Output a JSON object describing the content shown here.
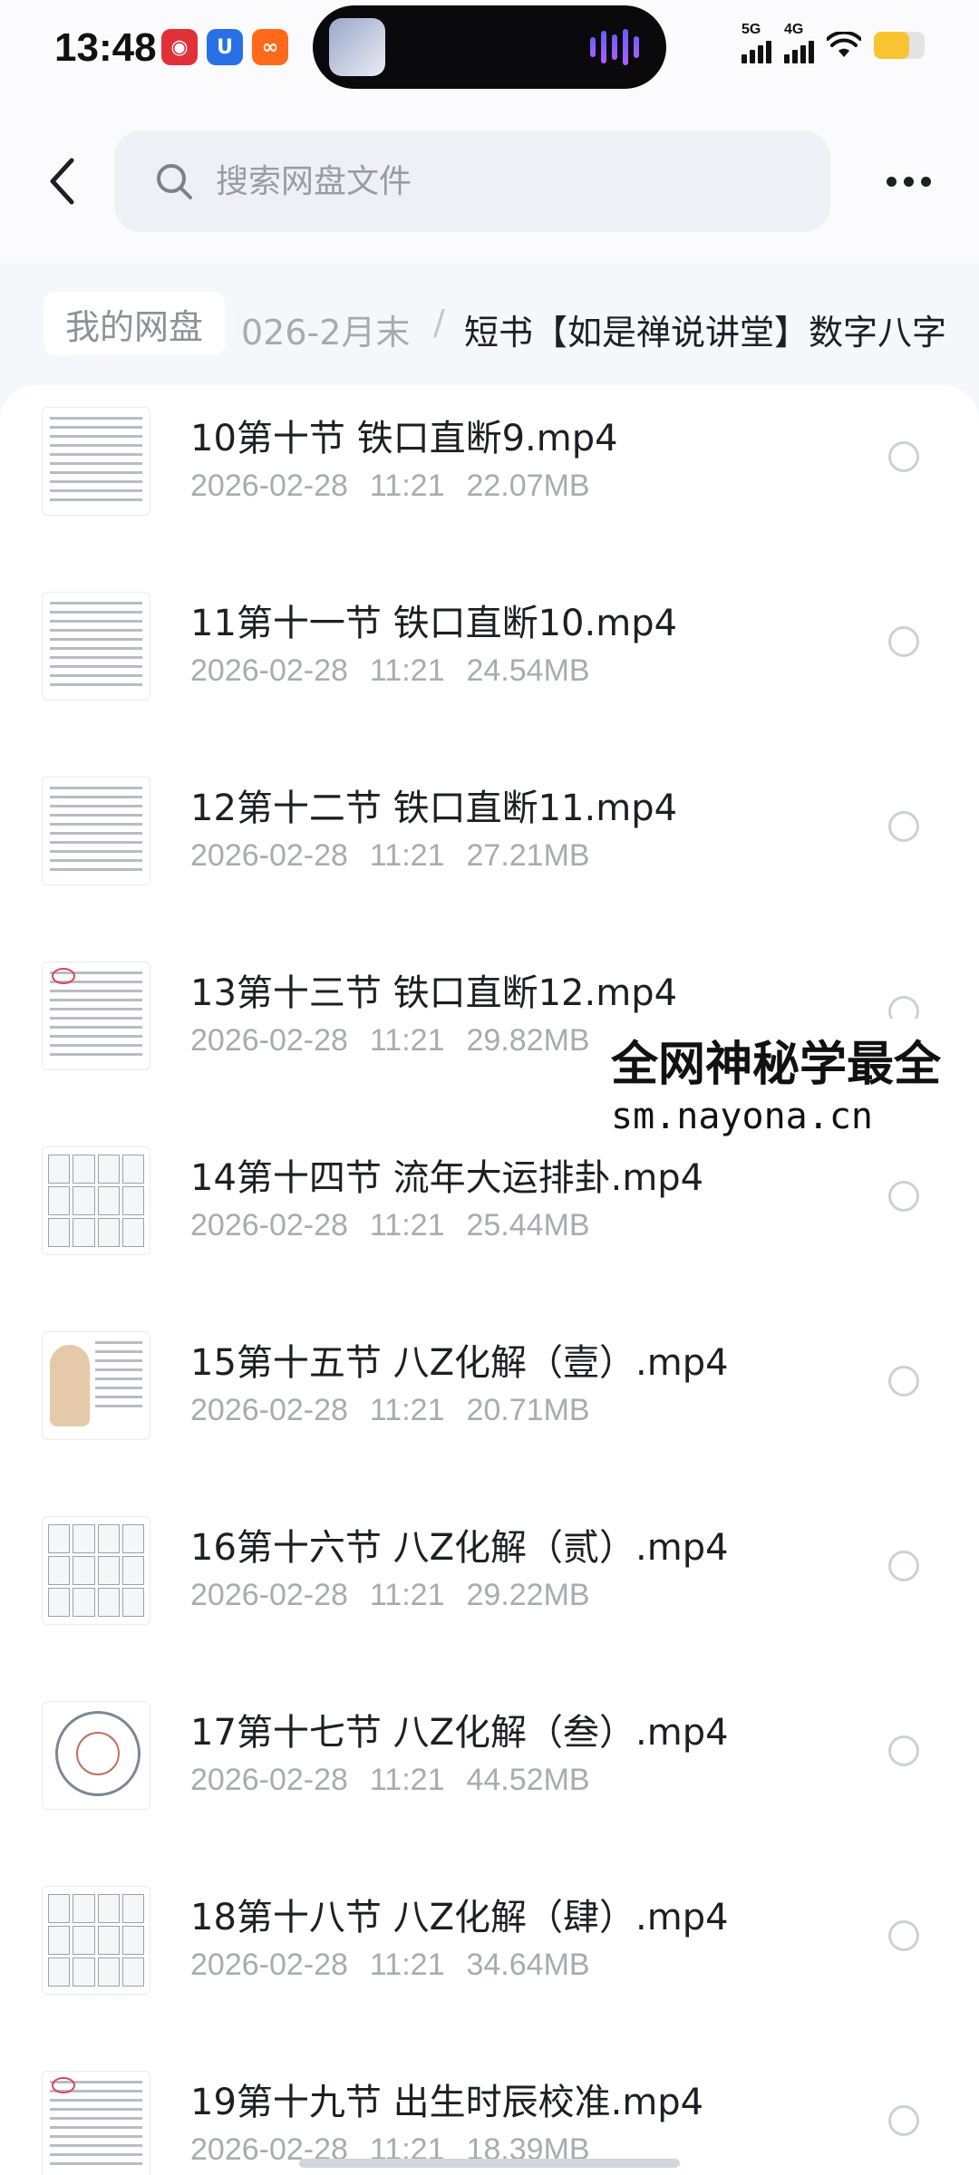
{
  "status_bar": {
    "time": "13:48",
    "app_icons": [
      "app-icon-red",
      "app-icon-blue-u",
      "app-icon-orange"
    ],
    "network_1": "5G",
    "network_2": "4G",
    "battery_level": 0.7,
    "battery_color": "#f7c531"
  },
  "top_bar": {
    "search_placeholder": "搜索网盘文件"
  },
  "breadcrumb": {
    "root": "我的网盘",
    "middle": "026-2月末",
    "separator": "/",
    "current": "短书【如是禅说讲堂】数字八字"
  },
  "files": [
    {
      "name": "10第十节 铁口直断9.mp4",
      "date": "2026-02-28",
      "time": "11:21",
      "size": "22.07MB",
      "thumb": "text"
    },
    {
      "name": "11第十一节 铁口直断10.mp4",
      "date": "2026-02-28",
      "time": "11:21",
      "size": "24.54MB",
      "thumb": "text"
    },
    {
      "name": "12第十二节 铁口直断11.mp4",
      "date": "2026-02-28",
      "time": "11:21",
      "size": "27.21MB",
      "thumb": "text"
    },
    {
      "name": "13第十三节 铁口直断12.mp4",
      "date": "2026-02-28",
      "time": "11:21",
      "size": "29.82MB",
      "thumb": "text-marked"
    },
    {
      "name": "14第十四节 流年大运排卦.mp4",
      "date": "2026-02-28",
      "time": "11:21",
      "size": "25.44MB",
      "thumb": "grid"
    },
    {
      "name": "15第十五节 八Z化解（壹）.mp4",
      "date": "2026-02-28",
      "time": "11:21",
      "size": "20.71MB",
      "thumb": "figure"
    },
    {
      "name": "16第十六节 八Z化解（贰）.mp4",
      "date": "2026-02-28",
      "time": "11:21",
      "size": "29.22MB",
      "thumb": "grid"
    },
    {
      "name": "17第十七节 八Z化解（叁）.mp4",
      "date": "2026-02-28",
      "time": "11:21",
      "size": "44.52MB",
      "thumb": "wheel"
    },
    {
      "name": "18第十八节 八Z化解（肆）.mp4",
      "date": "2026-02-28",
      "time": "11:21",
      "size": "34.64MB",
      "thumb": "grid"
    },
    {
      "name": "19第十九节 出生时辰校准.mp4",
      "date": "2026-02-28",
      "time": "11:21",
      "size": "18.39MB",
      "thumb": "text-marked"
    }
  ],
  "watermark": {
    "line1": "全网神秘学最全",
    "line2": "sm.nayona.cn"
  }
}
